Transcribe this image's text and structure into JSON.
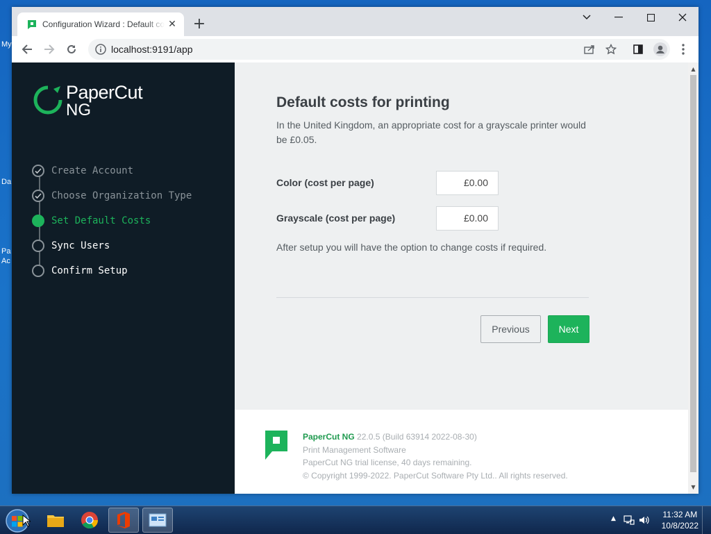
{
  "browser": {
    "tab_title": "Configuration Wizard : Default costs",
    "url": "localhost:9191/app"
  },
  "sidebar": {
    "logo_line1": "PaperCut",
    "logo_line2": "NG",
    "steps": [
      {
        "label": "Create Account",
        "state": "done"
      },
      {
        "label": "Choose Organization Type",
        "state": "done"
      },
      {
        "label": "Set Default Costs",
        "state": "active"
      },
      {
        "label": "Sync Users",
        "state": "pending"
      },
      {
        "label": "Confirm Setup",
        "state": "pending"
      }
    ]
  },
  "main": {
    "title": "Default costs for printing",
    "description": "In the United Kingdom, an appropriate cost for a grayscale printer would be £0.05.",
    "color_label": "Color (cost per page)",
    "color_value": "£0.00",
    "grayscale_label": "Grayscale (cost per page)",
    "grayscale_value": "£0.00",
    "note": "After setup you will have the option to change costs if required.",
    "previous_label": "Previous",
    "next_label": "Next"
  },
  "footer": {
    "product": "PaperCut NG",
    "version": "22.0.5 (Build 63914 2022-08-30)",
    "line2": "Print Management Software",
    "line3": "PaperCut NG trial license, 40 days remaining.",
    "line4": "© Copyright 1999-2022. PaperCut Software Pty Ltd.. All rights reserved."
  },
  "desktop": {
    "frag1": "My",
    "frag2": "Da",
    "frag3": "Pa",
    "frag4": "Ac"
  },
  "taskbar": {
    "time": "11:32 AM",
    "date": "10/8/2022"
  },
  "colors": {
    "accent_green": "#1db35b",
    "sidebar_bg": "#0f1c26"
  }
}
